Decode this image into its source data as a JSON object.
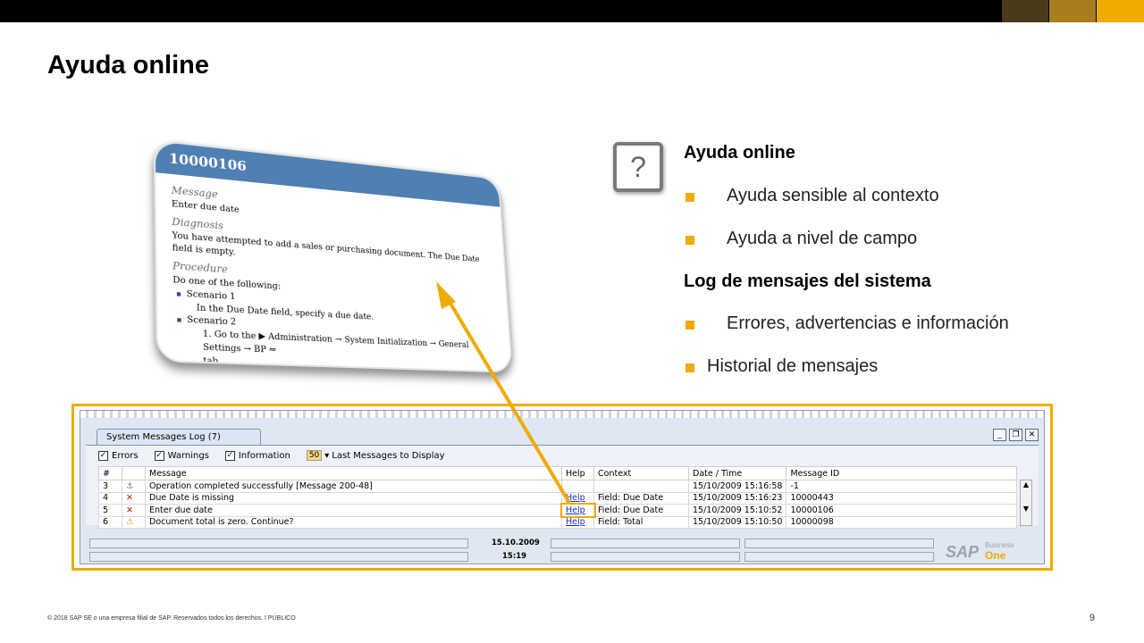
{
  "slide": {
    "title": "Ayuda online",
    "page_number": "9"
  },
  "footer": {
    "text": "© 2018 SAP SE o una empresa filial de SAP. Reservados todos los derechos.  I   PÚBLICO"
  },
  "colors": {
    "accent": "#f0ab00",
    "header_blue": "#4f7fb3"
  },
  "help_card": {
    "id": "10000106",
    "message_label": "Message",
    "message": "Enter due date",
    "diagnosis_label": "Diagnosis",
    "diagnosis": "You have attempted to add a sales or purchasing document. The Due Date field is empty.",
    "procedure_label": "Procedure",
    "procedure_intro": "Do one of the following:",
    "scenario1": "Scenario 1",
    "scenario1_text": "In the Due Date field, specify a due date.",
    "scenario2": "Scenario 2",
    "step": "1.   Go to the ▶ Administration → System Initialization → General Settings → BP ⇒",
    "step_tail": "tab."
  },
  "right": {
    "icon": "question-icon",
    "h1": "Ayuda online",
    "items1": [
      "Ayuda sensible al contexto",
      "Ayuda a nivel de campo"
    ],
    "h2": "Log de mensajes del sistema",
    "items2": [
      "Errores, advertencias e información"
    ],
    "item3": "Historial de mensajes"
  },
  "log_window": {
    "tab": "System Messages Log (7)",
    "filters": {
      "errors": "Errors",
      "warnings": "Warnings",
      "information": "Information",
      "count": "50",
      "count_label": "Last Messages to Display"
    },
    "columns": [
      "#",
      "",
      "Message",
      "Help",
      "Context",
      "Date / Time",
      "Message ID"
    ],
    "rows": [
      {
        "num": "3",
        "type": "info",
        "message": "Operation completed successfully  [Message 200-48]",
        "help": "",
        "context": "",
        "datetime": "15/10/2009  15:16:58",
        "id": "-1"
      },
      {
        "num": "4",
        "type": "error",
        "message": "Due Date is missing",
        "help": "Help",
        "context": "Field: Due Date",
        "datetime": "15/10/2009  15:16:23",
        "id": "10000443"
      },
      {
        "num": "5",
        "type": "error",
        "message": "Enter due date",
        "help": "Help",
        "context": "Field: Due Date",
        "datetime": "15/10/2009  15:10:52",
        "id": "10000106"
      },
      {
        "num": "6",
        "type": "warning",
        "message": "Document total is zero. Continue?",
        "help": "Help",
        "context": "Field: Total",
        "datetime": "15/10/2009  15:10:50",
        "id": "10000098"
      }
    ],
    "status": {
      "date": "15.10.2009",
      "time": "15:19"
    },
    "logo": {
      "sap": "SAP",
      "business": "Business",
      "one": "One"
    }
  }
}
